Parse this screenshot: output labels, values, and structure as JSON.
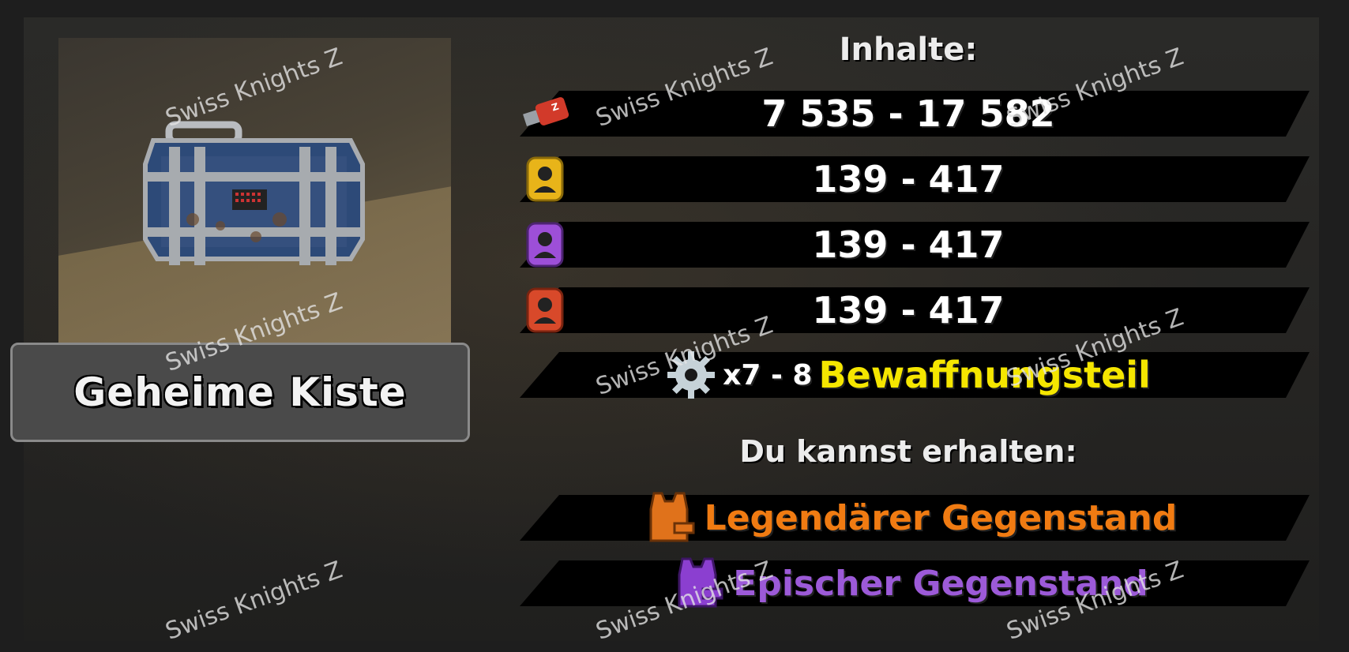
{
  "item": {
    "name": "Geheime Kiste"
  },
  "contents": {
    "heading": "Inhalte:",
    "rows": [
      {
        "icon": "usb-stick-icon",
        "value": "7 535 - 17 582"
      },
      {
        "icon": "yellow-survivor-card-icon",
        "value": "139 - 417"
      },
      {
        "icon": "purple-survivor-card-icon",
        "value": "139 - 417"
      },
      {
        "icon": "red-survivor-card-icon",
        "value": "139 - 417"
      }
    ],
    "gear": {
      "icon": "gear-icon",
      "quantity": "x7 - 8",
      "label": "Bewaffnungsteil"
    }
  },
  "possible": {
    "heading": "Du kannst erhalten:",
    "legendary": {
      "icon": "orange-vest-icon",
      "label": "Legendärer Gegenstand"
    },
    "epic": {
      "icon": "purple-vest-icon",
      "label": "Epischer Gegenstand"
    }
  },
  "watermark": "Swiss Knights Z",
  "colors": {
    "legendary": "#f07b12",
    "epic": "#9c5ad8",
    "gear_name": "#f5e600"
  }
}
